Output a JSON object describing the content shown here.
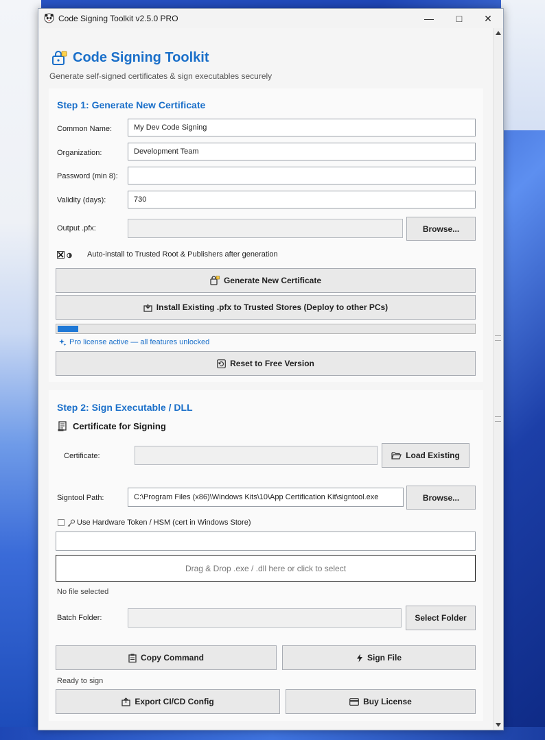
{
  "window": {
    "title": "Code Signing Toolkit v2.5.0  PRO",
    "min_glyph": "—",
    "max_glyph": "□",
    "close_glyph": "✕"
  },
  "header": {
    "title": "Code Signing Toolkit",
    "subtitle": "Generate self-signed certificates & sign executables securely"
  },
  "step1": {
    "title": "Step 1: Generate New Certificate",
    "common_name_label": "Common Name:",
    "common_name_value": "My Dev Code Signing",
    "organization_label": "Organization:",
    "organization_value": "Development Team",
    "password_label": "Password (min 8):",
    "password_value": "",
    "validity_label": "Validity (days):",
    "validity_value": "730",
    "output_label": "Output .pfx:",
    "output_value": "",
    "browse_label": "Browse...",
    "auto_install_label": "Auto-install to Trusted Root & Publishers after generation",
    "auto_install_checked": true,
    "generate_label": "Generate New Certificate",
    "install_label": "Install Existing .pfx to Trusted Stores (Deploy to other PCs)",
    "progress_fraction": 0.05,
    "pro_status": "Pro license active — all features unlocked",
    "reset_label": "Reset to Free Version"
  },
  "step2": {
    "title": "Step 2: Sign Executable / DLL",
    "cert_section_title": "Certificate for Signing",
    "certificate_label": "Certificate:",
    "certificate_value": "",
    "load_existing_label": "Load Existing",
    "signtool_label": "Signtool Path:",
    "signtool_value": "C:\\Program Files (x86)\\Windows Kits\\10\\App Certification Kit\\signtool.exe",
    "browse_label": "Browse...",
    "hsm_label": "Use Hardware Token / HSM (cert in Windows Store)",
    "hsm_checked": false,
    "hsm_value": "",
    "dropzone_label": "Drag & Drop .exe / .dll here or click to select",
    "file_status": "No file selected",
    "batch_label": "Batch Folder:",
    "batch_value": "",
    "select_folder_label": "Select Folder",
    "copy_command_label": "Copy Command",
    "sign_file_label": "Sign File",
    "ready_status": "Ready to sign",
    "export_label": "Export CI/CD Config",
    "buy_label": "Buy License"
  },
  "colors": {
    "accent": "#1a6fc9",
    "progress": "#1e78d6"
  }
}
